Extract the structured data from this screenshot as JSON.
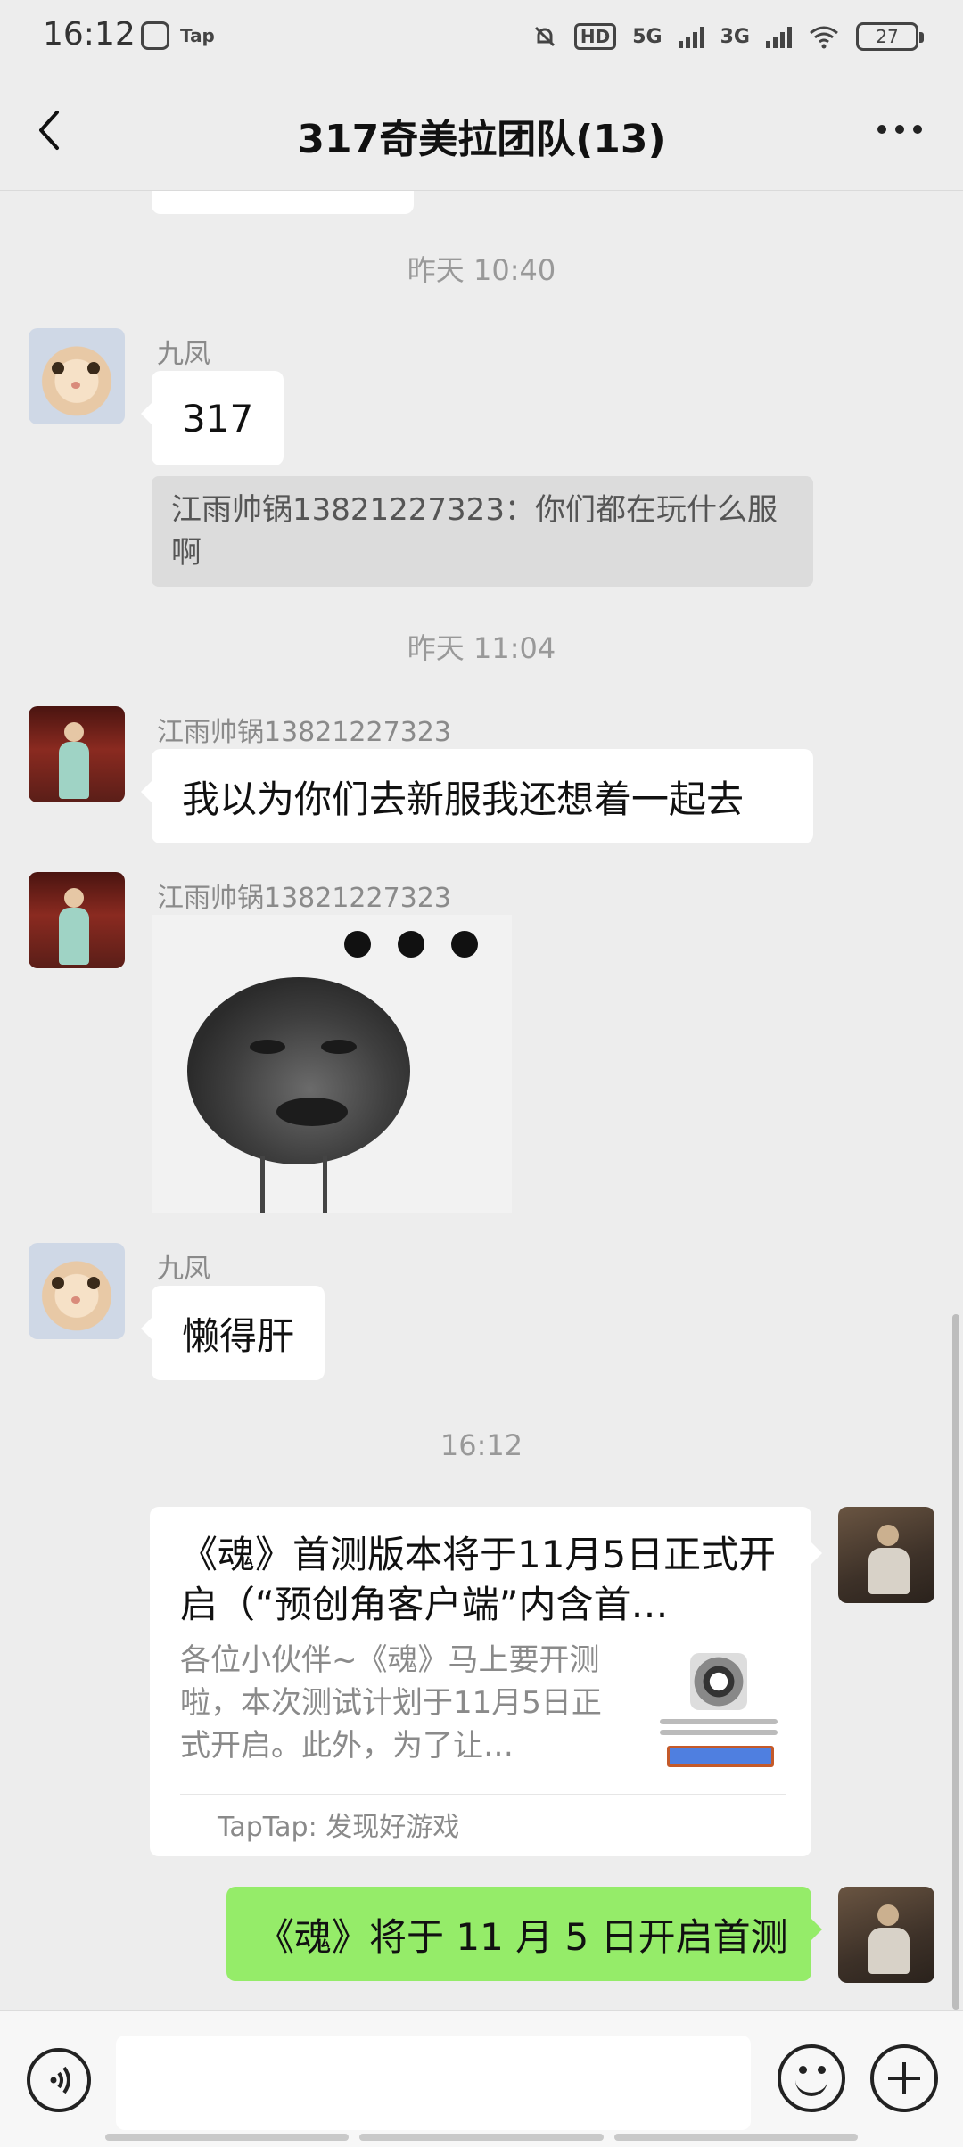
{
  "status_bar": {
    "time": "16:12",
    "app_badge": "Tap",
    "hd": "HD",
    "net1": "5G",
    "net2": "3G",
    "battery": "27",
    "icons": [
      "mute-bell-icon",
      "wifi-icon",
      "battery-icon"
    ]
  },
  "header": {
    "title": "317奇美拉团队(13)",
    "back_icon": "back-chevron-icon",
    "more_icon": "more-dots-icon"
  },
  "messages": {
    "ts1": "昨天 10:40",
    "m1": {
      "sender": "九凤",
      "text": "317"
    },
    "quote": "江雨帅锅13821227323：你们都在玩什么服啊",
    "ts2": "昨天 11:04",
    "m2": {
      "sender": "江雨帅锅13821227323",
      "text": "我以为你们去新服我还想着一起去"
    },
    "m3": {
      "sender": "江雨帅锅13821227323",
      "sticker": "meme-face-sticker"
    },
    "m4": {
      "sender": "九凤",
      "text": "懒得肝"
    },
    "ts3": "16:12",
    "card": {
      "title": "《魂》首测版本将于11月5日正式开启（“预创角客户端”内含首…",
      "description": "各位小伙伴~《魂》马上要开测啦，本次测试计划于11月5日正式开启。此外，为了让…",
      "source": "TapTap: 发现好游戏"
    },
    "m5": {
      "text": "《魂》将于 11 月 5 日开启首测"
    }
  },
  "input_bar": {
    "placeholder": "",
    "icons": [
      "voice-icon",
      "emoji-icon",
      "plus-icon"
    ]
  }
}
